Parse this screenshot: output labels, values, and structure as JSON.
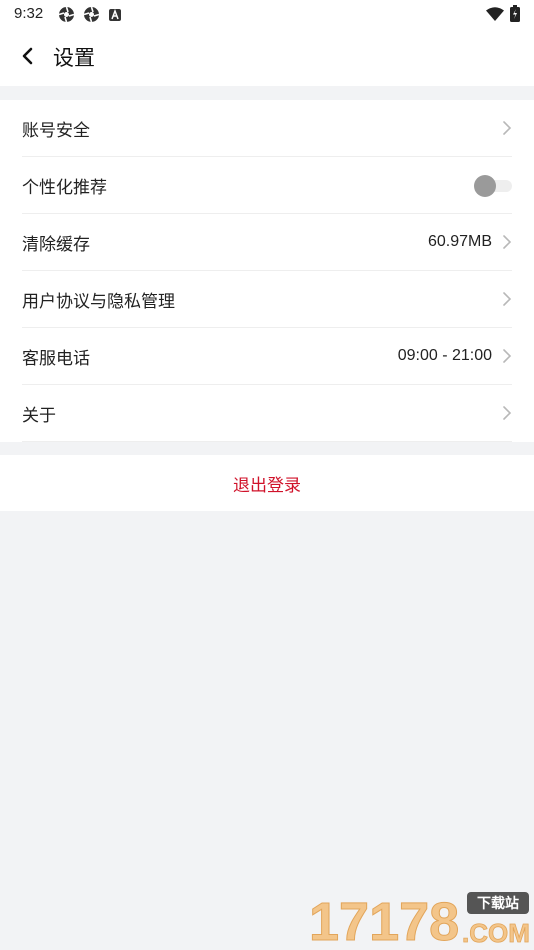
{
  "status_bar": {
    "time": "9:32",
    "icons": [
      "aperture-icon",
      "aperture-icon",
      "a-badge-icon"
    ],
    "right_icons": [
      "wifi-icon",
      "battery-icon"
    ]
  },
  "header": {
    "title": "设置",
    "back_icon": "chevron-left-icon"
  },
  "settings": {
    "items": [
      {
        "label": "账号安全",
        "value": "",
        "control": "chevron"
      },
      {
        "label": "个性化推荐",
        "value": "",
        "control": "toggle",
        "toggle_on": false
      },
      {
        "label": "清除缓存",
        "value": "60.97MB",
        "control": "chevron"
      },
      {
        "label": "用户协议与隐私管理",
        "value": "",
        "control": "chevron"
      },
      {
        "label": "客服电话",
        "value": "09:00 - 21:00",
        "control": "chevron"
      },
      {
        "label": "关于",
        "value": "",
        "control": "chevron"
      }
    ]
  },
  "logout": {
    "label": "退出登录",
    "color": "#d0122a"
  },
  "watermark": {
    "text": "17178",
    "badge": "下载站",
    "suffix": ".COM"
  },
  "colors": {
    "background": "#f2f3f5",
    "card": "#ffffff",
    "accent": "#d0122a"
  }
}
